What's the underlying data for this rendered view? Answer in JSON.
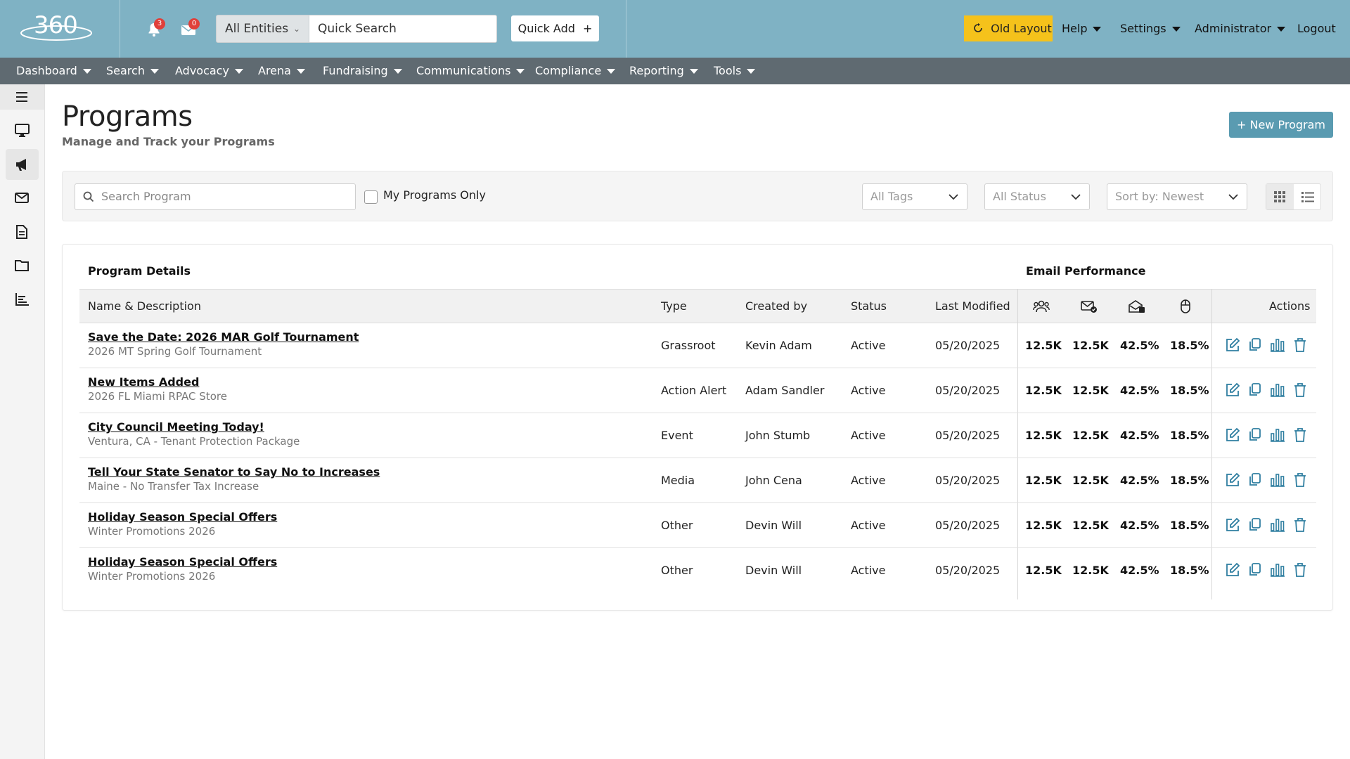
{
  "header": {
    "logo_text": "360",
    "notifications_count": "3",
    "messages_count": "0",
    "entity_select": "All Entities",
    "quick_search_placeholder": "Quick Search",
    "quick_add": "Quick Add",
    "old_layout": "Old Layout",
    "help": "Help",
    "settings": "Settings",
    "administrator": "Administrator",
    "logout": "Logout"
  },
  "nav": {
    "items": [
      {
        "label": "Dashboard"
      },
      {
        "label": "Search"
      },
      {
        "label": "Advocacy"
      },
      {
        "label": "Arena"
      },
      {
        "label": "Fundraising"
      },
      {
        "label": "Communications"
      },
      {
        "label": "Compliance"
      },
      {
        "label": "Reporting"
      },
      {
        "label": "Tools"
      }
    ]
  },
  "sidebar": {
    "icons": [
      "menu-icon",
      "monitor-icon",
      "megaphone-icon",
      "mail-icon",
      "document-icon",
      "folder-icon",
      "bar-chart-icon"
    ],
    "active": "megaphone-icon"
  },
  "page": {
    "title": "Programs",
    "subtitle": "Manage and Track your Programs",
    "new_button": "+ New Program"
  },
  "filters": {
    "search_placeholder": "Search Program",
    "my_programs_label": "My Programs Only",
    "my_programs_checked": false,
    "tags": "All Tags",
    "status": "All Status",
    "sort": "Sort by: Newest",
    "view_active": "grid"
  },
  "table": {
    "section_program": "Program Details",
    "section_email": "Email Performance",
    "columns": {
      "name": "Name & Description",
      "type": "Type",
      "created_by": "Created by",
      "status": "Status",
      "last_modified": "Last Modified",
      "actions": "Actions"
    },
    "metric_icons": [
      "recipients-icon",
      "delivered-icon",
      "opened-icon",
      "clicked-icon"
    ],
    "rows": [
      {
        "name": "Save the Date: 2026 MAR Golf Tournament",
        "desc": "2026 MT Spring Golf Tournament",
        "type": "Grassroot",
        "created_by": "Kevin Adam",
        "status": "Active",
        "modified": "05/20/2025",
        "m1": "12.5K",
        "m2": "12.5K",
        "m3": "42.5%",
        "m4": "18.5%"
      },
      {
        "name": "New Items Added",
        "desc": "2026 FL Miami RPAC Store",
        "type": "Action Alert",
        "created_by": "Adam Sandler",
        "status": "Active",
        "modified": "05/20/2025",
        "m1": "12.5K",
        "m2": "12.5K",
        "m3": "42.5%",
        "m4": "18.5%"
      },
      {
        "name": "City Council Meeting Today!",
        "desc": "Ventura, CA - Tenant Protection Package",
        "type": "Event",
        "created_by": "John Stumb",
        "status": "Active",
        "modified": "05/20/2025",
        "m1": "12.5K",
        "m2": "12.5K",
        "m3": "42.5%",
        "m4": "18.5%"
      },
      {
        "name": "Tell Your State Senator to Say No to Increases",
        "desc": "Maine - No Transfer Tax Increase",
        "type": "Media",
        "created_by": "John Cena",
        "status": "Active",
        "modified": "05/20/2025",
        "m1": "12.5K",
        "m2": "12.5K",
        "m3": "42.5%",
        "m4": "18.5%"
      },
      {
        "name": "Holiday Season Special Offers",
        "desc": "Winter Promotions 2026",
        "type": "Other",
        "created_by": "Devin Will",
        "status": "Active",
        "modified": "05/20/2025",
        "m1": "12.5K",
        "m2": "12.5K",
        "m3": "42.5%",
        "m4": "18.5%"
      },
      {
        "name": "Holiday Season Special Offers",
        "desc": "Winter Promotions 2026",
        "type": "Other",
        "created_by": "Devin Will",
        "status": "Active",
        "modified": "05/20/2025",
        "m1": "12.5K",
        "m2": "12.5K",
        "m3": "42.5%",
        "m4": "18.5%"
      }
    ]
  },
  "colors": {
    "header_bg": "#7fb2c4",
    "nav_bg": "#5f6a71",
    "accent": "#5a9bb1",
    "old_layout": "#f5c21b",
    "badge": "#e0403a"
  }
}
